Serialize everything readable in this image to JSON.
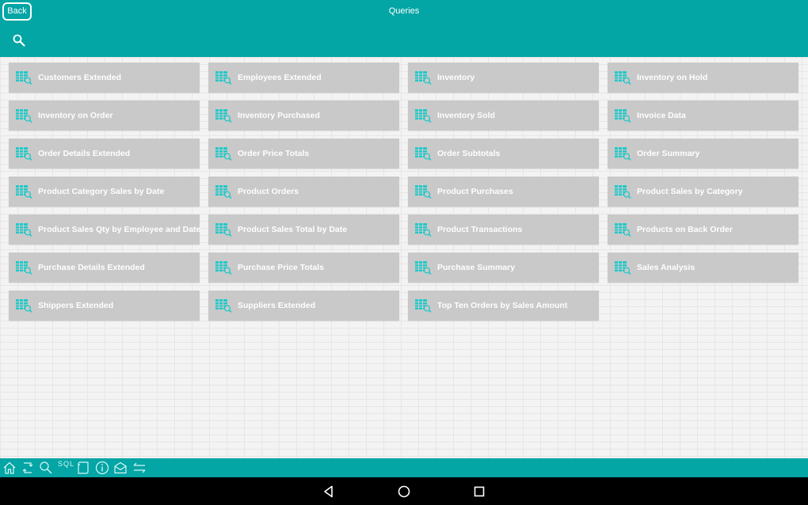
{
  "header": {
    "back_label": "Back",
    "title": "Queries"
  },
  "queries": [
    "Customers Extended",
    "Employees Extended",
    "Inventory",
    "Inventory on Hold",
    "Inventory on Order",
    "Inventory Purchased",
    "Inventory Sold",
    "Invoice Data",
    "Order Details Extended",
    "Order Price Totals",
    "Order Subtotals",
    "Order Summary",
    "Product Category Sales by Date",
    "Product Orders",
    "Product Purchases",
    "Product Sales by Category",
    "Product Sales Qty by Employee and Date",
    "Product Sales Total by Date",
    "Product Transactions",
    "Products on Back Order",
    "Purchase Details Extended",
    "Purchase Price Totals",
    "Purchase Summary",
    "Sales Analysis",
    "Shippers Extended",
    "Suppliers Extended",
    "Top Ten Orders by Sales Amount"
  ],
  "toolbar": {
    "sql_label": "SQL",
    "icons": [
      "home-icon",
      "refresh-icon",
      "search-icon",
      "sql-icon",
      "scroll-icon",
      "info-icon",
      "mail-icon",
      "exchange-icon"
    ]
  },
  "colors": {
    "accent": "#03a5a5",
    "tile": "#c9c9c9",
    "tile_icon": "#1fc9c9"
  }
}
